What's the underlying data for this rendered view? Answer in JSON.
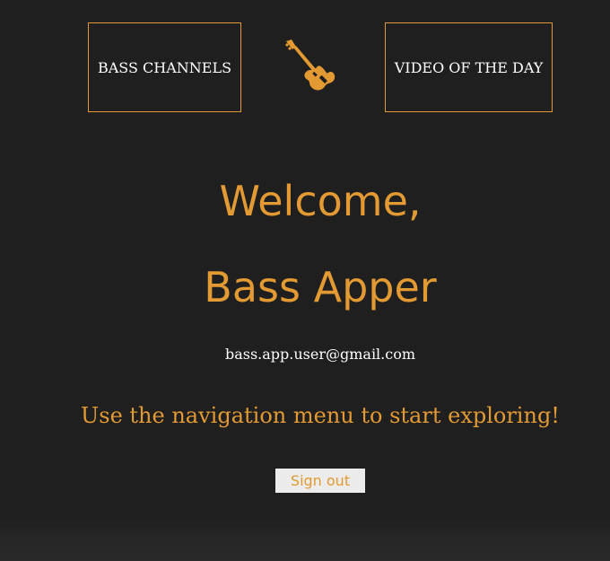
{
  "nav": {
    "channels_label": "BASS CHANNELS",
    "video_label": "VIDEO OF THE DAY",
    "logo_icon": "bass-guitar-icon"
  },
  "main": {
    "welcome": "Welcome,",
    "username": "Bass Apper",
    "email": "bass.app.user@gmail.com",
    "explore_text": "Use the navigation menu to start exploring!",
    "signout_label": "Sign out"
  },
  "colors": {
    "background": "#1f1f1f",
    "accent": "#e39a33",
    "text": "#ffffff",
    "button_bg": "#ececec"
  }
}
